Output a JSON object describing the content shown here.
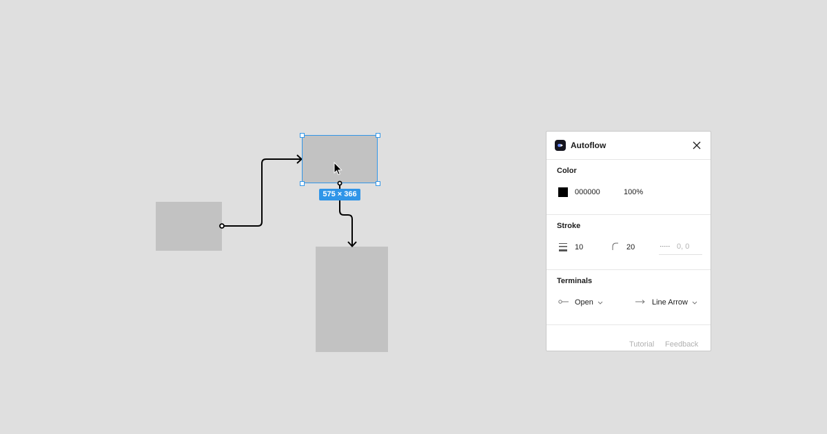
{
  "canvas": {
    "selection_size_label": "575 × 366"
  },
  "panel": {
    "title": "Autoflow",
    "color": {
      "title": "Color",
      "hex": "000000",
      "opacity": "100%",
      "swatch": "#000000"
    },
    "stroke": {
      "title": "Stroke",
      "weight": "10",
      "corner_radius": "20",
      "dash_placeholder": "0, 0"
    },
    "terminals": {
      "title": "Terminals",
      "start": "Open",
      "end": "Line Arrow"
    },
    "footer": {
      "tutorial": "Tutorial",
      "feedback": "Feedback"
    }
  },
  "colors": {
    "canvas_bg": "#dfdfdf",
    "shape_fill": "#c2c2c2",
    "selection": "#2f95e8",
    "connector": "#000000"
  }
}
